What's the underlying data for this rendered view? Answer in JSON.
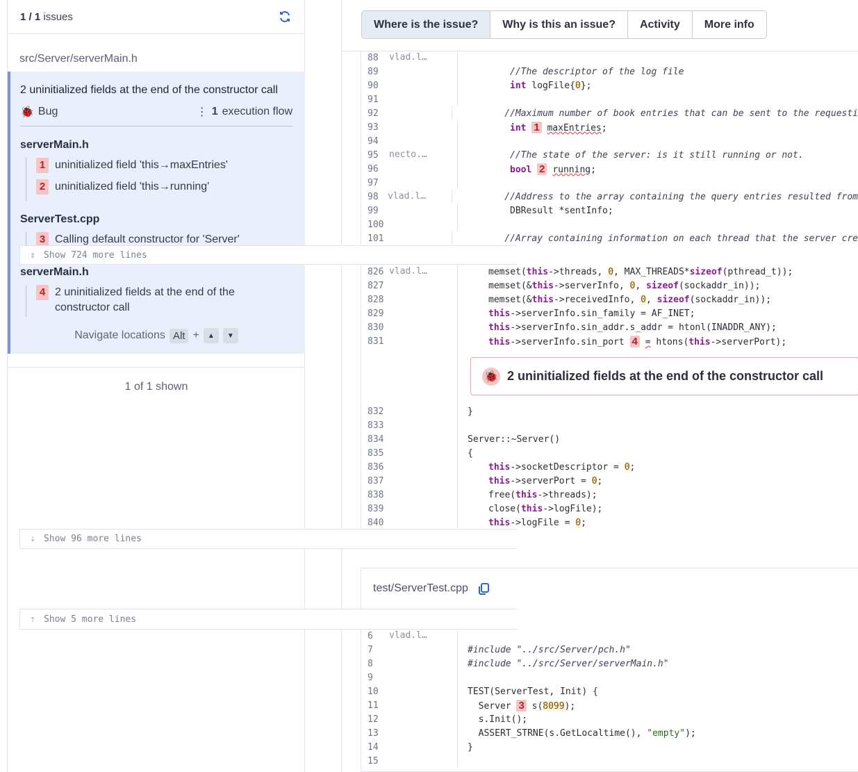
{
  "left": {
    "count": "1 / 1",
    "count_suffix": "issues",
    "file_path": "src/Server/serverMain.h",
    "issue": {
      "title": "2 uninitialized fields at the end of the constructor call",
      "type": "Bug",
      "flows_count": "1",
      "flows_label": "execution flow",
      "groups": [
        {
          "file": "serverMain.h",
          "steps": [
            {
              "num": "1",
              "text": "uninitialized field 'this→maxEntries'"
            },
            {
              "num": "2",
              "text": "uninitialized field 'this→running'"
            }
          ]
        },
        {
          "file": "ServerTest.cpp",
          "steps": [
            {
              "num": "3",
              "text": "Calling default constructor for 'Server'"
            }
          ]
        },
        {
          "file": "serverMain.h",
          "steps": [
            {
              "num": "4",
              "text": "2 uninitialized fields at the end of the constructor call"
            }
          ]
        }
      ],
      "nav_label": "Navigate locations",
      "nav_key": "Alt",
      "nav_plus": "+"
    },
    "shown": "1 of 1 shown"
  },
  "tabs": [
    "Where is the issue?",
    "Why is this an issue?",
    "Activity",
    "More info"
  ],
  "code": {
    "expand1": "Show 724 more lines",
    "expand2": "Show 96 more lines",
    "issue_box": "2 uninitialized fields at the end of the constructor call",
    "test_file": "test/ServerTest.cpp",
    "expand3": "Show 5 more lines",
    "block1": [
      {
        "ln": "88",
        "au": "vlad.l…"
      },
      {
        "ln": "89"
      },
      {
        "ln": "90"
      },
      {
        "ln": "91"
      },
      {
        "ln": "92"
      },
      {
        "ln": "93"
      },
      {
        "ln": "94"
      },
      {
        "ln": "95",
        "au": "necto.…"
      },
      {
        "ln": "96"
      },
      {
        "ln": "97"
      },
      {
        "ln": "98",
        "au": "vlad.l…"
      },
      {
        "ln": "99"
      },
      {
        "ln": "100"
      },
      {
        "ln": "101"
      }
    ],
    "block2": [
      {
        "ln": "826",
        "au": "vlad.l…"
      },
      {
        "ln": "827"
      },
      {
        "ln": "828"
      },
      {
        "ln": "829"
      },
      {
        "ln": "830"
      },
      {
        "ln": "831"
      }
    ],
    "block3": [
      {
        "ln": "832"
      },
      {
        "ln": "833"
      },
      {
        "ln": "834"
      },
      {
        "ln": "835"
      },
      {
        "ln": "836"
      },
      {
        "ln": "837"
      },
      {
        "ln": "838"
      },
      {
        "ln": "839"
      },
      {
        "ln": "840"
      }
    ],
    "block4": [
      {
        "ln": "6",
        "au": "vlad.l…"
      },
      {
        "ln": "7"
      },
      {
        "ln": "8"
      },
      {
        "ln": "9"
      },
      {
        "ln": "10"
      },
      {
        "ln": "11"
      },
      {
        "ln": "12"
      },
      {
        "ln": "13"
      },
      {
        "ln": "14"
      },
      {
        "ln": "15"
      }
    ],
    "src": {
      "l89": "//The descriptor of the log file",
      "l90a": "int",
      "l90b": " logFile{",
      "l90c": "0",
      "l90d": "};",
      "l92": "//Maximum number of book entries that can be sent to the requesti",
      "l93a": "int",
      "l93n": "1",
      "l93b": "maxEntries",
      ";": ";",
      "l95": "//The state of the server: is it still running or not.",
      "l96a": "bool",
      "l96n": "2",
      "l96b": "running",
      "l98": "//Address to the array containing the query entries resulted from",
      "l99": "DBResult *sentInfo;",
      "l101": "//Array containing information on each thread that the server cre",
      "l826a": "memset(",
      "this": "this",
      "l826b": "->threads, ",
      "zero": "0",
      "l826c": ", MAX_THREADS*",
      "sizeof": "sizeof",
      "l826d": "(pthread_t));",
      "l827a": "memset(&",
      "l827b": "->serverInfo, ",
      "l827c": "(sockaddr_in));",
      "l828b": "->receivedInfo, ",
      "l829b": "->serverInfo.sin_family = AF_INET;",
      "l830b": "->serverInfo.sin_addr.s_addr = htonl(INADDR_ANY);",
      "l831b": "->serverInfo.sin_port ",
      "l831n": "4",
      "l831eq": "=",
      "l831c": " htons(",
      "l831d": "->serverPort);",
      "l832": "}",
      "l834": "Server::~Server()",
      "l835": "{",
      "l836b": "->socketDescriptor = ",
      "l837b": "->serverPort = ",
      "l838a": "free(",
      "l838b": "->threads);",
      "l839a": "close(",
      "l839b": "->logFile);",
      "l840b": "->logFile = ",
      "semi": ";",
      "t7": "#include \"../src/Server/pch.h\"",
      "t8": "#include \"../src/Server/serverMain.h\"",
      "t10": "TEST(ServerTest, Init) {",
      "t11a": "  Server ",
      "t11n": "3",
      "t11b": "s(",
      "t11c": "8099",
      "t11d": ");",
      "t12": "  s.Init();",
      "t13a": "  ASSERT_STRNE(s.GetLocaltime(), ",
      "t13b": "\"empty\"",
      "t13c": ");",
      "t14": "}"
    }
  }
}
